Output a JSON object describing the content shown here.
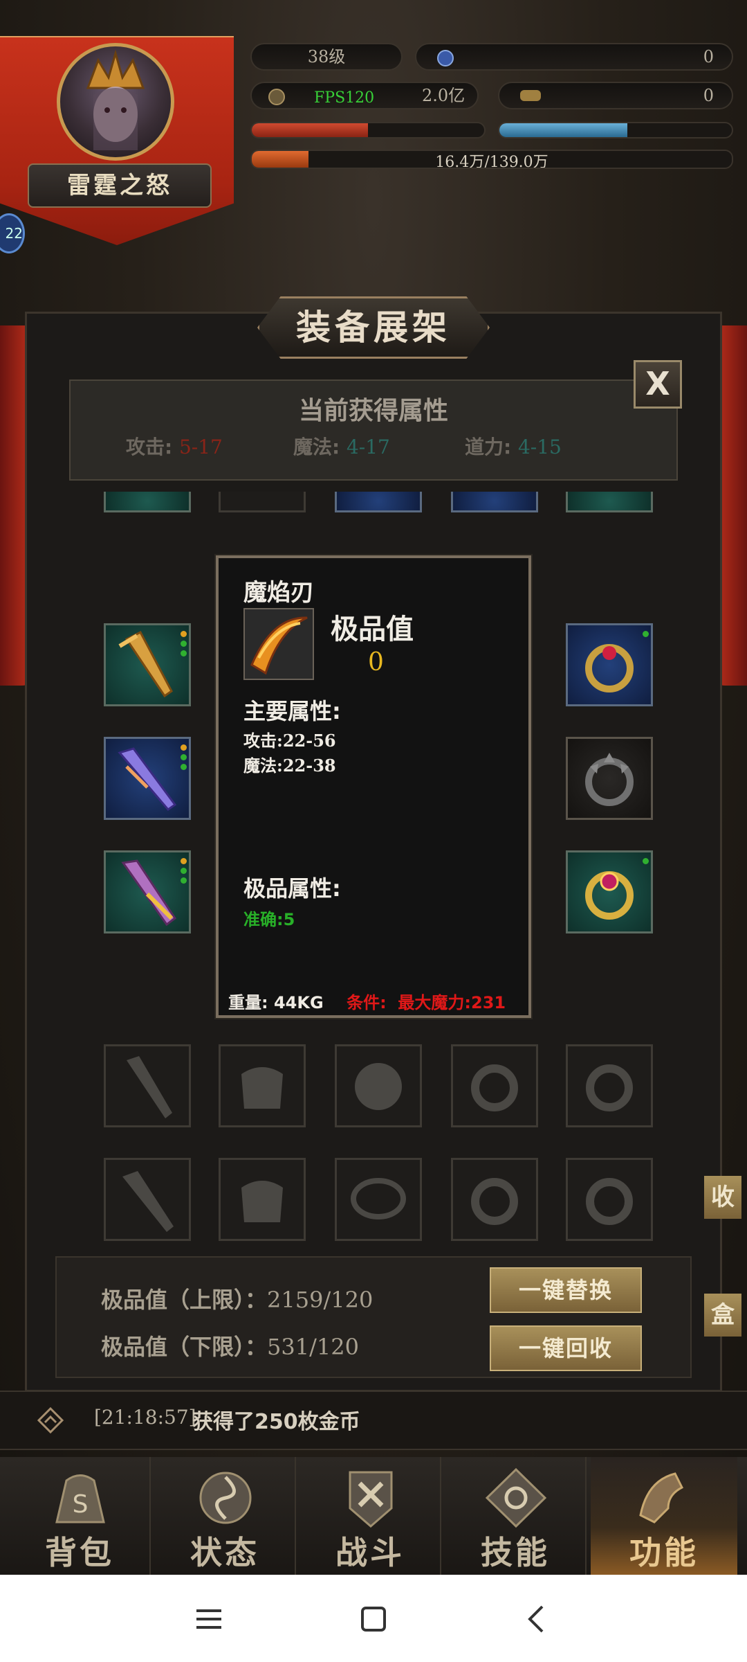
{
  "hud": {
    "player_name": "雷霆之怒",
    "level": "38级",
    "currency1_value": "0",
    "fps": "FPS120",
    "gold": "2.0亿",
    "ingot": "0",
    "exp_text": "16.4万/139.0万",
    "side_badge": "22",
    "hp_ratio": 0.5,
    "mp_ratio": 0.55,
    "exp_ratio": 0.118
  },
  "panel": {
    "title": "装备展架",
    "close_label": "X",
    "attr_title": "当前获得属性",
    "attrs": [
      {
        "label": "攻击",
        "value": "5-17",
        "color": "#8a2418"
      },
      {
        "label": "魔法",
        "value": "4-17",
        "color": "#2a6a62"
      },
      {
        "label": "道力",
        "value": "4-15",
        "color": "#2a6a62"
      }
    ]
  },
  "tooltip": {
    "name": "魔焰刃",
    "jipin_label": "极品值",
    "jipin_value": "0",
    "main_title": "主要属性:",
    "main_attrs": [
      "攻击:22-56",
      "魔法:22-38"
    ],
    "extra_title": "极品属性:",
    "extra_attrs": [
      "准确:5"
    ],
    "weight": "重量:  44KG",
    "condition_label": "条件:",
    "condition_value": "最大魔力:231"
  },
  "limits": {
    "upper_label": "极品值（上限）：",
    "upper_value": "2159/120",
    "lower_label": "极品值（下限）：",
    "lower_value": "531/120",
    "replace_btn": "一键替换",
    "recycle_btn": "一键回收"
  },
  "side_buttons": [
    "收",
    "盒"
  ],
  "chat": {
    "time": "[21:18:57]",
    "message": "获得了250枚金币"
  },
  "nav": [
    {
      "label": "背包",
      "icon": "bag-icon"
    },
    {
      "label": "状态",
      "icon": "status-icon"
    },
    {
      "label": "战斗",
      "icon": "battle-icon"
    },
    {
      "label": "技能",
      "icon": "skill-icon"
    },
    {
      "label": "功能",
      "icon": "function-icon"
    }
  ]
}
